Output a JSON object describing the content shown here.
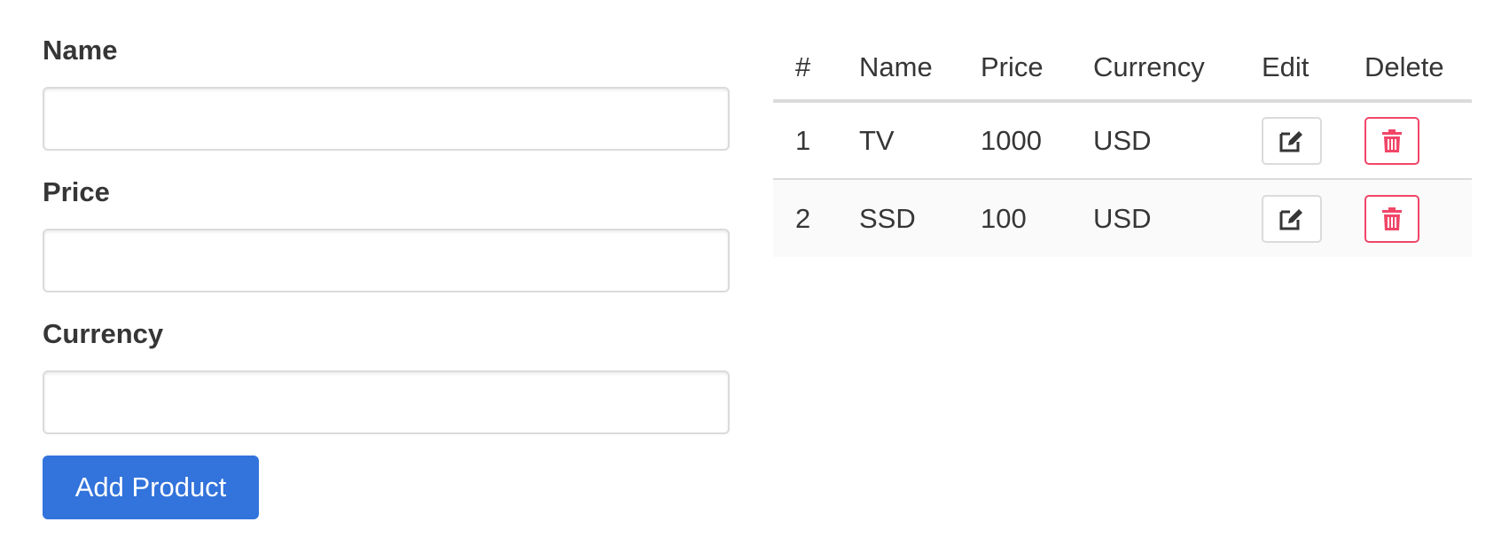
{
  "form": {
    "name_label": "Name",
    "name_value": "",
    "price_label": "Price",
    "price_value": "",
    "currency_label": "Currency",
    "currency_value": "",
    "submit_label": "Add Product"
  },
  "table": {
    "headers": {
      "num": "#",
      "name": "Name",
      "price": "Price",
      "currency": "Currency",
      "edit": "Edit",
      "delete": "Delete"
    },
    "rows": [
      {
        "num": "1",
        "name": "TV",
        "price": "1000",
        "currency": "USD"
      },
      {
        "num": "2",
        "name": "SSD",
        "price": "100",
        "currency": "USD"
      }
    ]
  },
  "icons": {
    "edit": "edit-icon",
    "delete": "trash-icon"
  },
  "colors": {
    "primary": "#3273dc",
    "danger": "#f14668",
    "text": "#363636",
    "border": "#dbdbdb",
    "row_stripe": "#fafafa"
  }
}
